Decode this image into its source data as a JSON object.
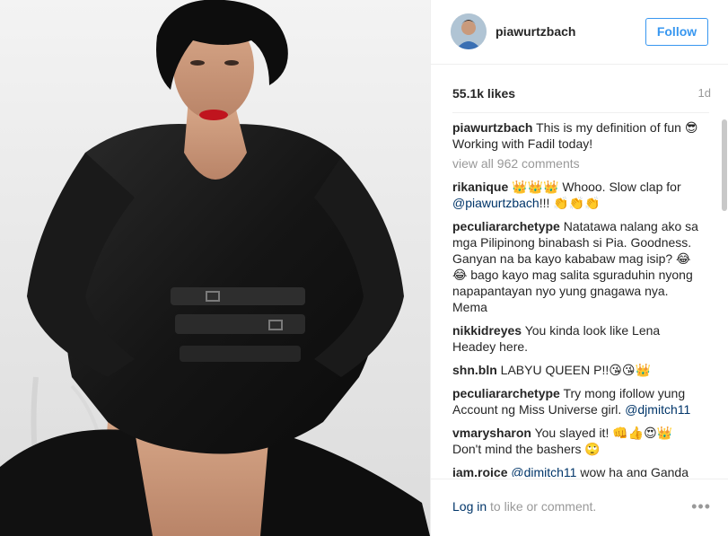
{
  "post": {
    "image_alt": "Woman in black leather jacket and corset belt posing on a clear chair"
  },
  "header": {
    "username": "piawurtzbach",
    "follow_label": "Follow"
  },
  "stats": {
    "likes": "55.1k likes",
    "time": "1d"
  },
  "caption": {
    "user": "piawurtzbach",
    "text": "This is my definition of fun 😎 Working with Fadil today!"
  },
  "view_all": "view all 962 comments",
  "comments": [
    {
      "user": "rikanique",
      "text": "👑👑👑 Whooo. Slow clap for ",
      "mention": "@piawurtzbach",
      "after": "!!! 👏👏👏"
    },
    {
      "user": "peculiararchetype",
      "text": "Natatawa nalang ako sa mga Pilipinong binabash si Pia. Goodness. Ganyan na ba kayo kababaw mag isip? 😂😂 bago kayo mag salita sguraduhin nyong napapantayan nyo yung gnagawa nya. Mema",
      "mention": "",
      "after": ""
    },
    {
      "user": "nikkidreyes",
      "text": "You kinda look like Lena Headey here.",
      "mention": "",
      "after": ""
    },
    {
      "user": "shn.bln",
      "text": "LABYU QUEEN P!!😘😘👑",
      "mention": "",
      "after": ""
    },
    {
      "user": "peculiararchetype",
      "text": "Try mong ifollow yung Account ng Miss Universe girl. ",
      "mention": "@djmitch11",
      "after": ""
    },
    {
      "user": "vmarysharon",
      "text": "You slayed it! 👊👍😍👑 Don't mind the bashers 🙄",
      "mention": "",
      "after": ""
    },
    {
      "user": "iam.roice",
      "text": "",
      "mention": "@djmitch11",
      "after": " wow ha ang Ganda"
    }
  ],
  "footer": {
    "login_link": "Log in",
    "login_text": " to like or comment.",
    "more_label": "•••"
  }
}
